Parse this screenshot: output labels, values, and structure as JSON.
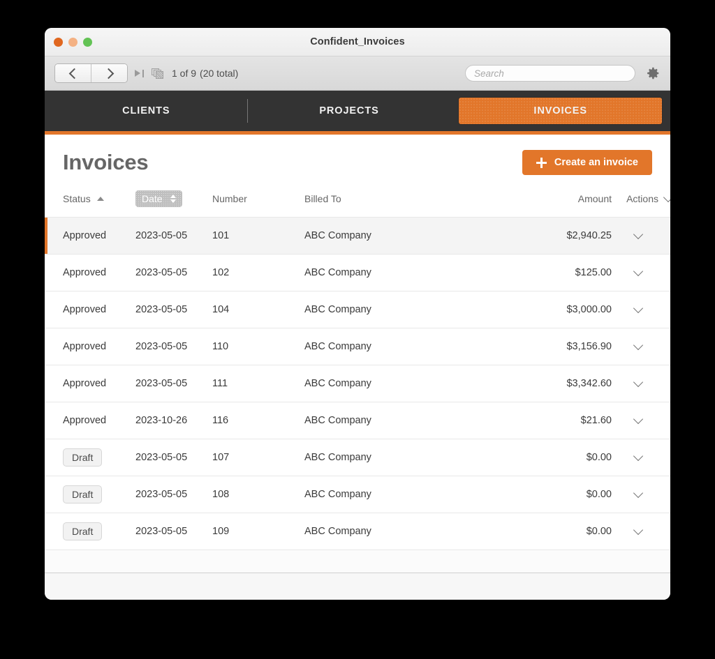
{
  "window": {
    "title": "Confident_Invoices",
    "controls": [
      {
        "name": "close-button",
        "color": "#e0671f"
      },
      {
        "name": "minimize-button",
        "color": "#f4b183"
      },
      {
        "name": "zoom-button",
        "color": "#62c254"
      }
    ]
  },
  "toolbar": {
    "back_label": "",
    "forward_label": "",
    "skip_icon": "skip-to-end-icon",
    "stack_icon": "record-stack-icon",
    "record_position": "1 of 9",
    "record_total": "(20 total)",
    "search_placeholder": "Search",
    "search_value": "",
    "settings_icon": "gear-icon"
  },
  "nav": {
    "tabs": [
      {
        "label": "CLIENTS",
        "active": false
      },
      {
        "label": "PROJECTS",
        "active": false
      },
      {
        "label": "INVOICES",
        "active": true
      }
    ],
    "accent_color": "#e2762a",
    "bar_color": "#333333"
  },
  "page": {
    "title": "Invoices",
    "create_button": "Create an invoice"
  },
  "table": {
    "columns": [
      {
        "key": "status",
        "label": "Status",
        "sort": "asc",
        "align": "left"
      },
      {
        "key": "date",
        "label": "Date",
        "sort": "both",
        "align": "left"
      },
      {
        "key": "number",
        "label": "Number",
        "sort": "none",
        "align": "left"
      },
      {
        "key": "billed",
        "label": "Billed To",
        "sort": "none",
        "align": "left"
      },
      {
        "key": "amount",
        "label": "Amount",
        "sort": "none",
        "align": "right"
      },
      {
        "key": "actions",
        "label": "Actions",
        "sort": "menu",
        "align": "right"
      }
    ],
    "rows": [
      {
        "status": "Approved",
        "badge": false,
        "date": "2023-05-05",
        "number": "101",
        "billed": "ABC Company",
        "amount": "$2,940.25",
        "selected": true
      },
      {
        "status": "Approved",
        "badge": false,
        "date": "2023-05-05",
        "number": "102",
        "billed": "ABC Company",
        "amount": "$125.00",
        "selected": false
      },
      {
        "status": "Approved",
        "badge": false,
        "date": "2023-05-05",
        "number": "104",
        "billed": "ABC Company",
        "amount": "$3,000.00",
        "selected": false
      },
      {
        "status": "Approved",
        "badge": false,
        "date": "2023-05-05",
        "number": "110",
        "billed": "ABC Company",
        "amount": "$3,156.90",
        "selected": false
      },
      {
        "status": "Approved",
        "badge": false,
        "date": "2023-05-05",
        "number": "111",
        "billed": "ABC Company",
        "amount": "$3,342.60",
        "selected": false
      },
      {
        "status": "Approved",
        "badge": false,
        "date": "2023-10-26",
        "number": "116",
        "billed": "ABC Company",
        "amount": "$21.60",
        "selected": false
      },
      {
        "status": "Draft",
        "badge": true,
        "date": "2023-05-05",
        "number": "107",
        "billed": "ABC Company",
        "amount": "$0.00",
        "selected": false
      },
      {
        "status": "Draft",
        "badge": true,
        "date": "2023-05-05",
        "number": "108",
        "billed": "ABC Company",
        "amount": "$0.00",
        "selected": false
      },
      {
        "status": "Draft",
        "badge": true,
        "date": "2023-05-05",
        "number": "109",
        "billed": "ABC Company",
        "amount": "$0.00",
        "selected": false
      }
    ]
  }
}
